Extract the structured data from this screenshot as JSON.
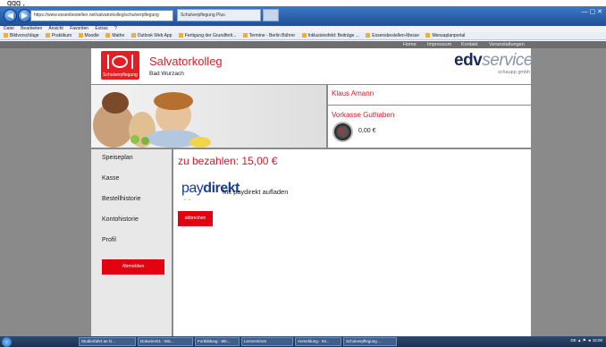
{
  "caption": "ggg                              ,",
  "browser": {
    "address": "https://www.essenbestellen.net/salvatorkolleg/schulverpflegung",
    "tab_title": "Schulverpflegung Plus",
    "window_controls": "— ▢ ✕",
    "menu": [
      "Datei",
      "Bearbeiten",
      "Ansicht",
      "Favoriten",
      "Extras",
      "?"
    ],
    "favorites": [
      "Bildvorschläge",
      "Praktikum",
      "Moodle",
      "Mathe",
      "Outlook Web App",
      "Fertigung der Grundferti...",
      "Termine - Berlin Bührer",
      "Inklusionsfeld: Beiträge ...",
      "Essensbestellen-Messe",
      "Mensaplanportal"
    ]
  },
  "topnav": {
    "home": "Home",
    "impressum": "Impressum",
    "kontakt": "Kontakt",
    "veranstaltungen": "Veranstaltungen"
  },
  "header": {
    "logo_text": "Schulverpflegung",
    "org_name": "Salvatorkolleg",
    "org_city": "Bad Wurzach",
    "brand_main": "edv",
    "brand_service": "service",
    "brand_sub": "schaupp gmbh"
  },
  "account": {
    "user_name": "Klaus Amann",
    "credit_label": "Vorkasse Guthaben",
    "credit_value": "0,00 €"
  },
  "sidebar": {
    "items": [
      "Speiseplan",
      "Kasse",
      "Bestellhistorie",
      "Kontohistorie",
      "Profil"
    ],
    "logout": "Abmelden"
  },
  "payment": {
    "title": "zu bezahlen: 15,00 €",
    "logo_pay": "pay",
    "logo_direkt": "direkt",
    "logo_dots": "•·•",
    "text": "Mit paydirekt aufladen",
    "cancel": "abbrechen"
  },
  "taskbar": {
    "items": [
      "Studierfahrt an G...",
      "Dokument1 - Mic...",
      "Fortbildung - Mic...",
      "Lernzentrum",
      "Anmeldung - Int...",
      "Schulverpflegung ..."
    ],
    "tray": "DE  ▲  ⚑  ◄  15:00"
  }
}
